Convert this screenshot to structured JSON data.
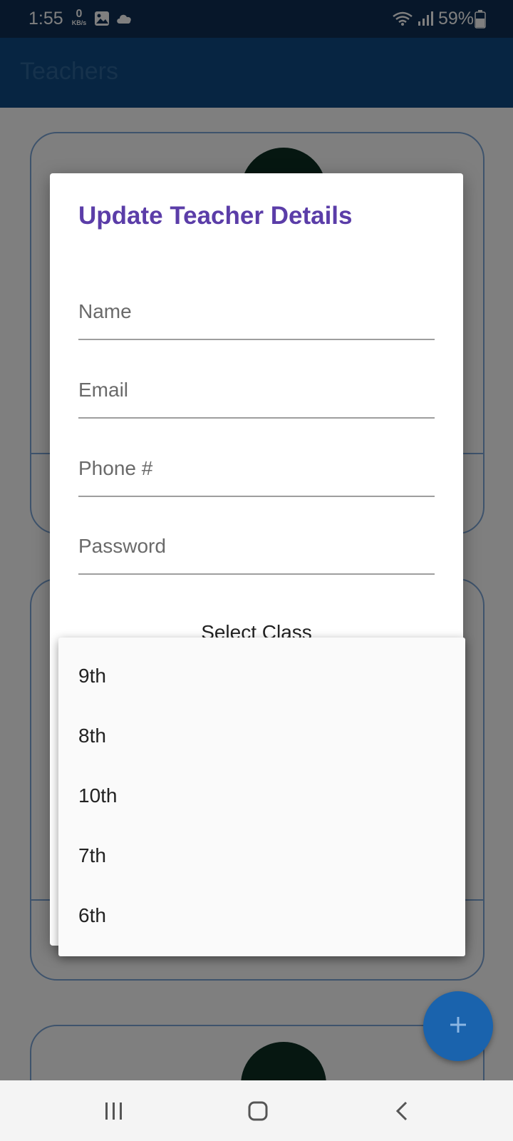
{
  "status_bar": {
    "time": "1:55",
    "net_speed_value": "0",
    "net_speed_unit": "KB/s",
    "battery_percent": "59%",
    "icons": [
      "image-icon",
      "cloud-icon",
      "wifi-icon",
      "signal-icon",
      "battery-icon"
    ]
  },
  "app_bar": {
    "title": "Teachers"
  },
  "dialog": {
    "title": "Update Teacher Details",
    "fields": [
      {
        "label": "Name"
      },
      {
        "label": "Email"
      },
      {
        "label": "Phone #"
      },
      {
        "label": "Password"
      }
    ],
    "select_label": "Select Class"
  },
  "dropdown": {
    "options": [
      "9th",
      "8th",
      "10th",
      "7th",
      "6th"
    ]
  },
  "fab": {
    "icon": "plus-icon"
  },
  "nav_bar": {
    "icons": [
      "recent-apps-icon",
      "home-icon",
      "back-icon"
    ]
  },
  "colors": {
    "status_bar": "#0f2f54",
    "app_bar": "#0f4a85",
    "dialog_title": "#5b3da8",
    "fab": "#1a63ad",
    "card_border": "#7da7d9"
  }
}
